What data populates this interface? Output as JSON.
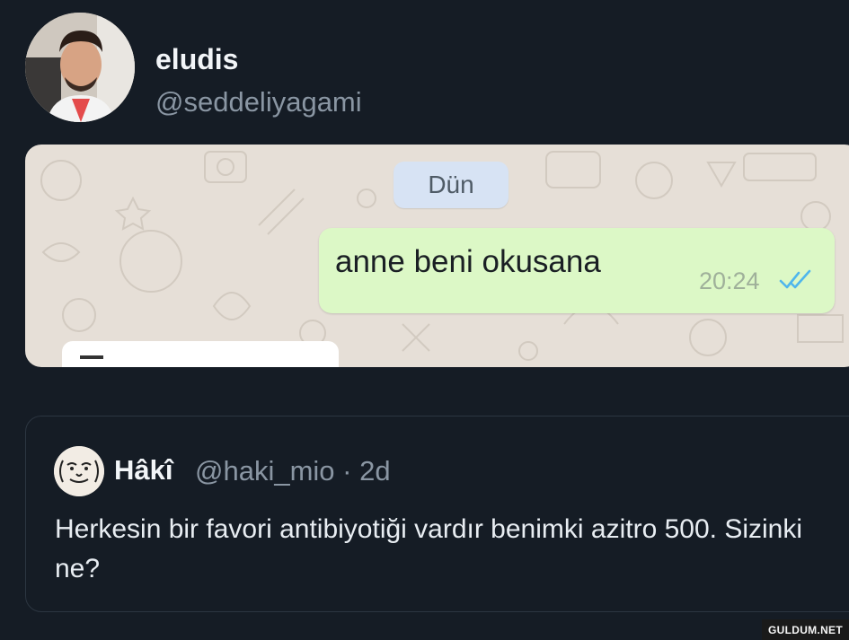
{
  "profile": {
    "display_name": "eludis",
    "handle": "@seddeliyagami"
  },
  "chat": {
    "date_label": "Dün",
    "message": {
      "text": "anne beni okusana",
      "time": "20:24",
      "status_icon": "double-check-read-icon",
      "status_color": "#4fb6ec"
    },
    "bubble_color": "#dcf8c6",
    "wallpaper_color": "#e6dfd7"
  },
  "quoted_tweet": {
    "author_name": "Hâkî",
    "author_meta": "@haki_mio · 2d",
    "text": "Herkesin bir favori antibiyotiği vardır benimki azitro 500. Sizinki ne?"
  },
  "watermark": {
    "text": "GULDUM.NET"
  },
  "colors": {
    "background": "#151c25",
    "muted_text": "#8a96a3",
    "primary_text": "#e8edf2"
  }
}
